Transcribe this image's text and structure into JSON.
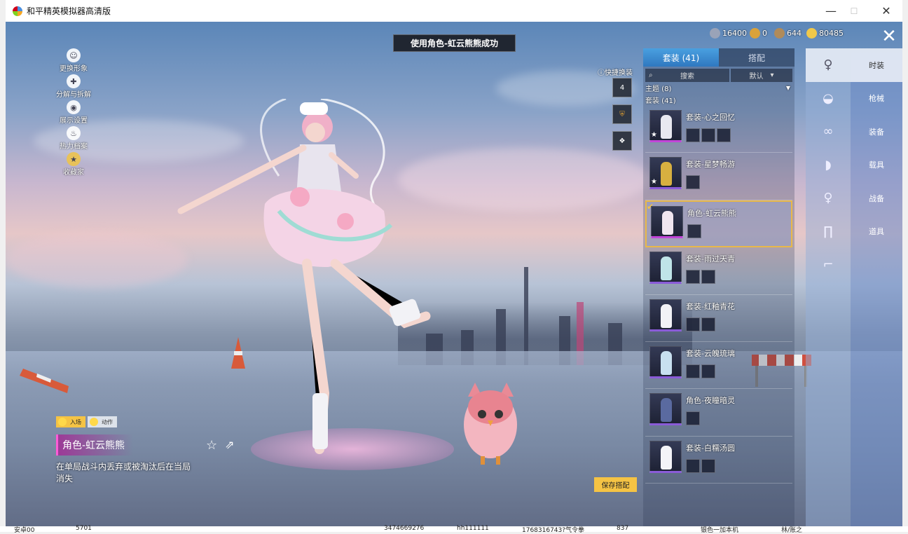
{
  "window": {
    "title": "和平精英模拟器高清版",
    "minimize": "—",
    "maximize": "☐",
    "close": "✕"
  },
  "toast": "使用角色-虹云熊熊成功",
  "left_menu": [
    {
      "label": "更换形象",
      "icon": "person-icon",
      "glyph": "☺"
    },
    {
      "label": "分解与拆解",
      "icon": "puzzle-icon",
      "glyph": "✚"
    },
    {
      "label": "展示设置",
      "icon": "eye-icon",
      "glyph": "◉"
    },
    {
      "label": "热力档案",
      "icon": "flame-icon",
      "glyph": "♨"
    },
    {
      "label": "收藏家",
      "icon": "collector-badge-icon",
      "glyph": "★"
    }
  ],
  "currencies": [
    {
      "value": "16400",
      "icon": "silver-coin-icon",
      "color": "#9aa3b8"
    },
    {
      "value": "0",
      "icon": "gold-medal-icon",
      "color": "#d9a23a"
    },
    {
      "value": "644",
      "icon": "ticket-icon",
      "color": "#b08b5a"
    },
    {
      "value": "80485",
      "icon": "gold-coin-icon",
      "color": "#f0c84a"
    }
  ],
  "quick_change": {
    "label": "快捷换装",
    "slot_number": "4"
  },
  "anim_tabs": [
    "入场",
    "动作"
  ],
  "current_item": {
    "name": "角色-虹云熊熊",
    "description": "在单局战斗内丢弃或被淘汰后在当局消失"
  },
  "save_button": "保存搭配",
  "panel": {
    "tabs": [
      "套装 (41)",
      "搭配"
    ],
    "search_label": "搜索",
    "sort_label": "默认",
    "theme_header": "主题 (8)",
    "outfits_header": "套装 (41)",
    "outfits": [
      {
        "name": "套装-心之回忆",
        "parts": 3,
        "star": true,
        "selected": false
      },
      {
        "name": "套装-星梦畅游",
        "parts": 1,
        "star": true,
        "selected": false
      },
      {
        "name": "角色-虹云熊熊",
        "parts": 1,
        "star": false,
        "selected": true
      },
      {
        "name": "套装-雨过天青",
        "parts": 2,
        "star": false,
        "selected": false
      },
      {
        "name": "套装-红釉青花",
        "parts": 2,
        "star": false,
        "selected": false
      },
      {
        "name": "套装-云魄琉璃",
        "parts": 2,
        "star": false,
        "selected": false
      },
      {
        "name": "角色-夜瞳暗灵",
        "parts": 1,
        "star": false,
        "selected": false
      },
      {
        "name": "套装-白糯汤圆",
        "parts": 2,
        "star": false,
        "selected": false
      }
    ]
  },
  "slots": [
    {
      "icon": "character-icon",
      "glyph": "♀",
      "active": true
    },
    {
      "icon": "hat-icon",
      "glyph": "◒",
      "active": false
    },
    {
      "icon": "glasses-icon",
      "glyph": "∞",
      "active": false
    },
    {
      "icon": "mask-icon",
      "glyph": "◗",
      "active": false
    },
    {
      "icon": "top-icon",
      "glyph": "♀",
      "active": false
    },
    {
      "icon": "pants-icon",
      "glyph": "∏",
      "active": false
    },
    {
      "icon": "shoes-icon",
      "glyph": "⌐",
      "active": false
    }
  ],
  "categories": [
    {
      "label": "时装",
      "active": true
    },
    {
      "label": "枪械",
      "active": false
    },
    {
      "label": "装备",
      "active": false
    },
    {
      "label": "载具",
      "active": false
    },
    {
      "label": "战备",
      "active": false
    },
    {
      "label": "道具",
      "active": false
    }
  ],
  "background_strip": [
    "安卓00",
    "5701",
    "3474669276",
    "hh111111",
    "1768316743?气令拳",
    "837",
    "银色一加本机",
    "林/账之"
  ]
}
